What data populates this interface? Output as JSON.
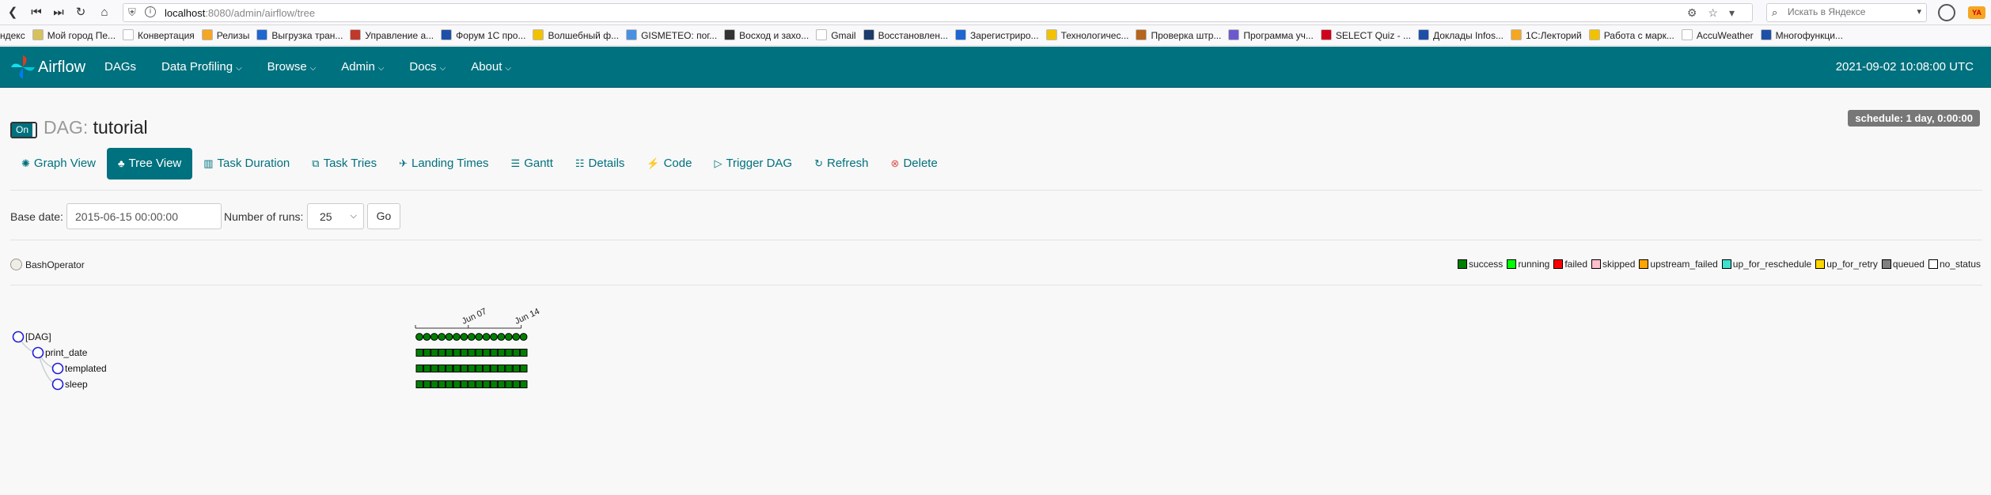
{
  "browser": {
    "url_host": "localhost",
    "url_rest": ":8080/admin/airflow/tree",
    "search_placeholder": "Искать в Яндексе",
    "bookmarks": [
      {
        "label": "ндекс",
        "color": "#ffffff"
      },
      {
        "label": "Мой город Пе...",
        "color": "#d8c15b"
      },
      {
        "label": "Конвертация",
        "color": "#ffffff"
      },
      {
        "label": "Релизы",
        "color": "#f5a623"
      },
      {
        "label": "Выгрузка тран...",
        "color": "#1e66d0"
      },
      {
        "label": "Управление а...",
        "color": "#c0392b"
      },
      {
        "label": "Форум 1С про...",
        "color": "#1e4fa8"
      },
      {
        "label": "Волшебный ф...",
        "color": "#f2c200"
      },
      {
        "label": "GISMETEO: пог...",
        "color": "#4a90e2"
      },
      {
        "label": "Восход и захо...",
        "color": "#333333"
      },
      {
        "label": "Gmail",
        "color": "#ffffff"
      },
      {
        "label": "Восстановлен...",
        "color": "#1a3b6b"
      },
      {
        "label": "Зарегистриро...",
        "color": "#1e66d0"
      },
      {
        "label": "Технологичес...",
        "color": "#f2c200"
      },
      {
        "label": "Проверка штр...",
        "color": "#b5651d"
      },
      {
        "label": "Программа уч...",
        "color": "#6a5acd"
      },
      {
        "label": "SELECT Quiz - ...",
        "color": "#d0021b"
      },
      {
        "label": "Доклады Infos...",
        "color": "#1e4fa8"
      },
      {
        "label": "1С:Лекторий",
        "color": "#f5a623"
      },
      {
        "label": "Работа с марк...",
        "color": "#f2c200"
      },
      {
        "label": "AccuWeather",
        "color": "#ffffff"
      },
      {
        "label": "Многофункци...",
        "color": "#1e4fa8"
      }
    ]
  },
  "navbar": {
    "brand": "Airflow",
    "menu": [
      {
        "label": "DAGs",
        "dropdown": false
      },
      {
        "label": "Data Profiling",
        "dropdown": true
      },
      {
        "label": "Browse",
        "dropdown": true
      },
      {
        "label": "Admin",
        "dropdown": true
      },
      {
        "label": "Docs",
        "dropdown": true
      },
      {
        "label": "About",
        "dropdown": true
      }
    ],
    "clock": "2021-09-02 10:08:00 UTC"
  },
  "dag": {
    "toggle": "On",
    "prefix": "DAG:",
    "name": "tutorial",
    "schedule": "schedule: 1 day, 0:00:00"
  },
  "tabs": [
    {
      "label": "Graph View",
      "icon": "✺",
      "active": false
    },
    {
      "label": "Tree View",
      "icon": "♣",
      "active": true
    },
    {
      "label": "Task Duration",
      "icon": "▥",
      "active": false
    },
    {
      "label": "Task Tries",
      "icon": "⧉",
      "active": false
    },
    {
      "label": "Landing Times",
      "icon": "✈",
      "active": false
    },
    {
      "label": "Gantt",
      "icon": "☰",
      "active": false
    },
    {
      "label": "Details",
      "icon": "☷",
      "active": false
    },
    {
      "label": "Code",
      "icon": "⚡",
      "active": false
    },
    {
      "label": "Trigger DAG",
      "icon": "▷",
      "active": false
    },
    {
      "label": "Refresh",
      "icon": "↻",
      "active": false
    },
    {
      "label": "Delete",
      "icon": "⊗",
      "active": false
    }
  ],
  "form": {
    "base_date_label": "Base date:",
    "base_date_value": "2015-06-15 00:00:00",
    "runs_label": "Number of runs:",
    "runs_value": "25",
    "go_label": "Go"
  },
  "operator": {
    "label": "BashOperator"
  },
  "legend": [
    {
      "label": "success",
      "color": "#008000"
    },
    {
      "label": "running",
      "color": "#00ff00"
    },
    {
      "label": "failed",
      "color": "#ff0000"
    },
    {
      "label": "skipped",
      "color": "#ffc0cb"
    },
    {
      "label": "upstream_failed",
      "color": "#ffa500"
    },
    {
      "label": "up_for_reschedule",
      "color": "#40e0d0"
    },
    {
      "label": "up_for_retry",
      "color": "#ffd700"
    },
    {
      "label": "queued",
      "color": "#808080"
    },
    {
      "label": "no_status",
      "color": "#ffffff"
    }
  ],
  "tree": {
    "nodes": [
      {
        "label": "[DAG]",
        "depth": 0
      },
      {
        "label": "print_date",
        "depth": 1
      },
      {
        "label": "templated",
        "depth": 2
      },
      {
        "label": "sleep",
        "depth": 2
      }
    ],
    "date_ticks": [
      "Jun 07",
      "Jun 14"
    ],
    "runs": 15,
    "run_state": "success",
    "run_color": "#008000"
  }
}
